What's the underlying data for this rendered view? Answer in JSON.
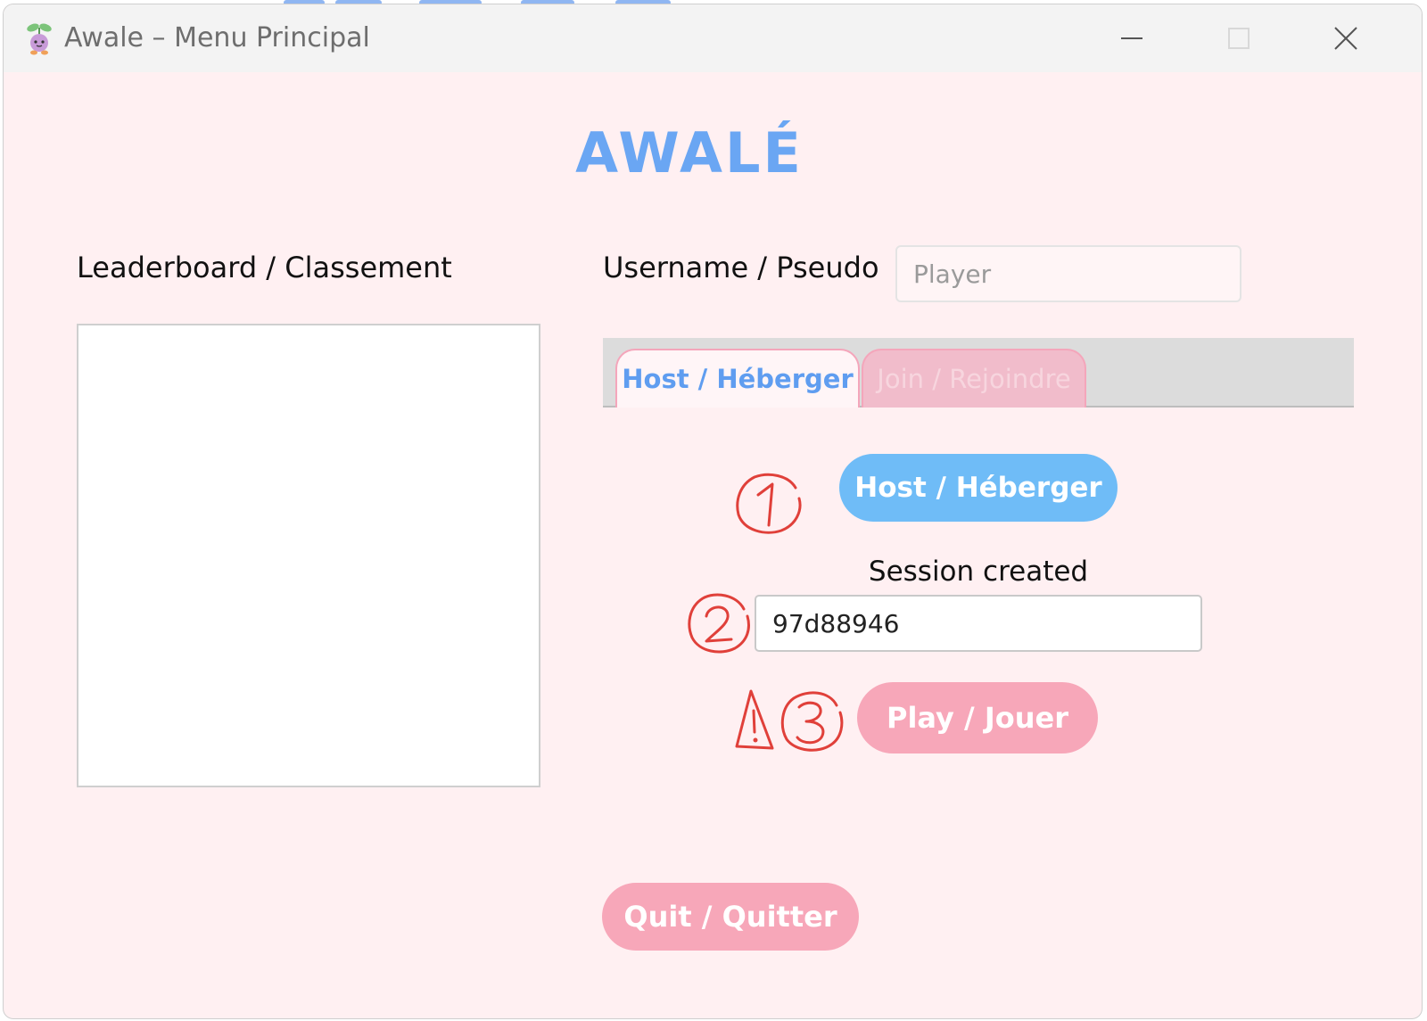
{
  "window": {
    "title": "Awale – Menu Principal",
    "controls": [
      "minimize",
      "maximize",
      "close"
    ]
  },
  "main": {
    "heading": "AWALÉ",
    "leaderboard": {
      "label": "Leaderboard / Classement",
      "entries": []
    },
    "username": {
      "label": "Username / Pseudo",
      "placeholder": "Player",
      "value": ""
    },
    "tabs": [
      {
        "label": "Host / Héberger",
        "active": true
      },
      {
        "label": "Join / Rejoindre",
        "active": false
      }
    ],
    "host_panel": {
      "host_button": "Host / Héberger",
      "session_label": "Session created",
      "session_id": "97d88946",
      "play_button": "Play / Jouer"
    },
    "quit_button": "Quit / Quitter"
  },
  "annotations": {
    "step1": "1",
    "step2": "2",
    "step3": "3",
    "warning_icon": "warning-icon"
  },
  "colors": {
    "window_bg": "#fff0f2",
    "titlebar_bg": "#f3f3f3",
    "heading": "#6aa6f3",
    "host_button": "#6fbcf7",
    "pink_button": "#f7a7b9",
    "active_tab_text": "#5f9df0",
    "annotation": "#e0403a"
  }
}
